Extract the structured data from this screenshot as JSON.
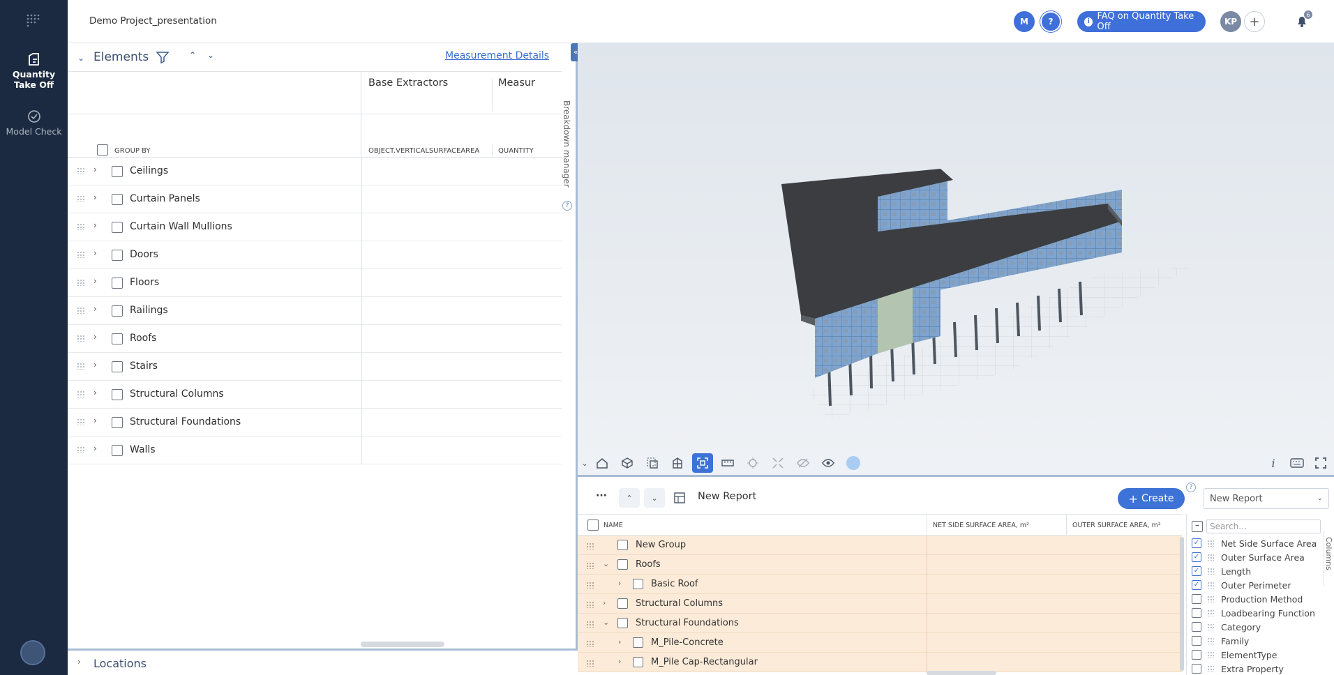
{
  "project_title": "Demo Project_presentation",
  "rail": {
    "items": [
      {
        "label": "Quantity Take Off"
      },
      {
        "label": "Model Check"
      }
    ]
  },
  "header": {
    "avatar_m": "M",
    "help": "?",
    "faq_label": "FAQ on Quantity Take Off",
    "avatar_kp": "KP",
    "add": "+",
    "notification_count": "6"
  },
  "elements": {
    "title": "Elements",
    "measurement_details": "Measurement Details",
    "group_by": "GROUP BY",
    "columns": [
      {
        "title": "Base Extractors",
        "sub": "OBJECT.VERTICALSURFACEAREA"
      },
      {
        "title": "Measur",
        "sub": "QUANTITY"
      }
    ],
    "rows": [
      "Ceilings",
      "Curtain Panels",
      "Curtain Wall Mullions",
      "Doors",
      "Floors",
      "Railings",
      "Roofs",
      "Stairs",
      "Structural Columns",
      "Structural Foundations",
      "Walls"
    ]
  },
  "breakdown_manager": "Breakdown manager",
  "locations": "Locations",
  "report": {
    "more": "···",
    "name": "New Report",
    "create_label": "Create",
    "select_value": "New Report",
    "headers": {
      "name": "NAME",
      "col1": "NET SIDE SURFACE AREA, m²",
      "col2": "OUTER SURFACE AREA, m²"
    },
    "rows": [
      {
        "label": "New Group",
        "level": 0,
        "expander": ""
      },
      {
        "label": "Roofs",
        "level": 0,
        "expander": "v"
      },
      {
        "label": "Basic Roof",
        "level": 1,
        "expander": ">"
      },
      {
        "label": "Structural Columns",
        "level": 0,
        "expander": ">"
      },
      {
        "label": "Structural Foundations",
        "level": 0,
        "expander": "v"
      },
      {
        "label": "M_Pile-Concrete",
        "level": 1,
        "expander": ">"
      },
      {
        "label": "M_Pile Cap-Rectangular",
        "level": 1,
        "expander": ">"
      }
    ]
  },
  "columns_panel": {
    "tab": "Columns",
    "search_placeholder": "Search...",
    "items": [
      {
        "label": "Net Side Surface Area",
        "checked": true
      },
      {
        "label": "Outer Surface Area",
        "checked": true
      },
      {
        "label": "Length",
        "checked": true
      },
      {
        "label": "Outer Perimeter",
        "checked": true
      },
      {
        "label": "Production Method",
        "checked": false
      },
      {
        "label": "Loadbearing Function",
        "checked": false
      },
      {
        "label": "Category",
        "checked": false
      },
      {
        "label": "Family",
        "checked": false
      },
      {
        "label": "ElementType",
        "checked": false
      },
      {
        "label": "Extra Property",
        "checked": false
      }
    ]
  },
  "colors": {
    "rail": "#1b2a40",
    "accent": "#3d72d6",
    "report_row": "#fcebd8"
  }
}
